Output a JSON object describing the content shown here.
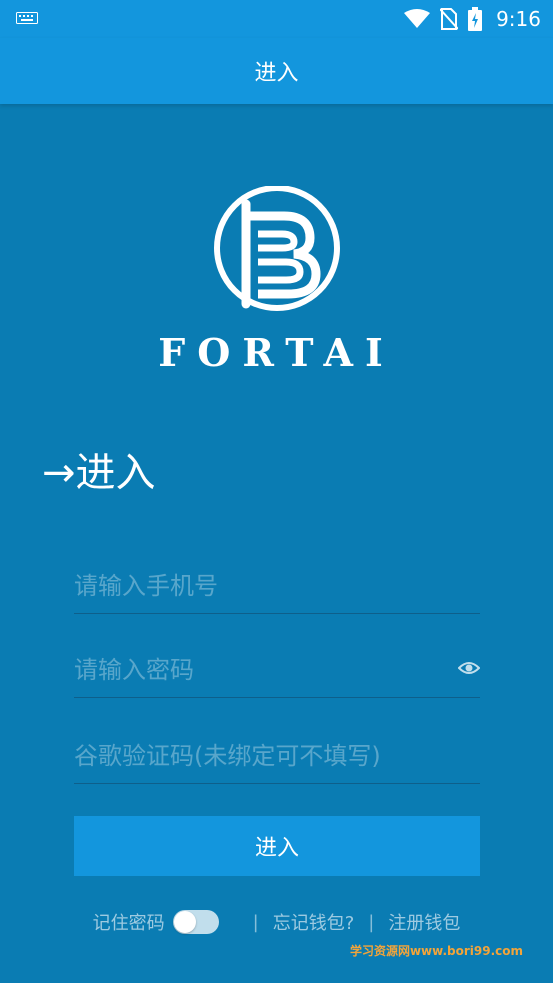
{
  "status_bar": {
    "time": "9:16",
    "icons": [
      "keyboard-icon",
      "wifi-icon",
      "no-sim-icon",
      "battery-icon"
    ]
  },
  "app_bar": {
    "title": "进入"
  },
  "logo": {
    "brand": "FORTAI"
  },
  "heading": "→进入",
  "form": {
    "phone_placeholder": "请输入手机号",
    "password_placeholder": "请输入密码",
    "captcha_placeholder": "谷歌验证码(未绑定可不填写)",
    "submit_label": "进入"
  },
  "footer": {
    "remember_label": "记住密码",
    "separator": "|",
    "forgot_label": "忘记钱包?",
    "register_label": "注册钱包"
  },
  "watermark": "学习资源网www.bori99.com",
  "colors": {
    "accent": "#1396dd",
    "background": "#0a7cb3"
  }
}
